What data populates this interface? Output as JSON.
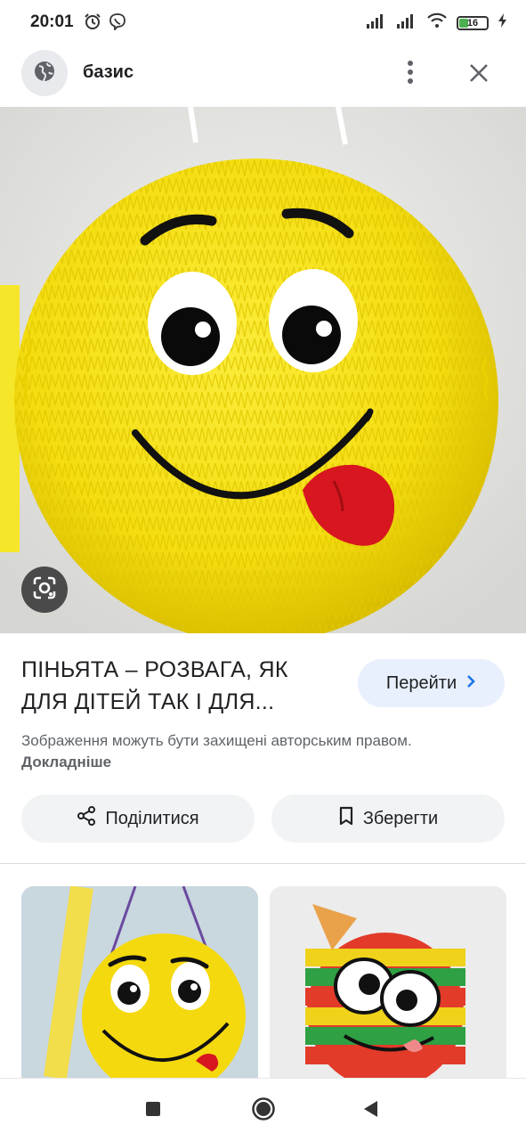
{
  "status_bar": {
    "time": "20:01",
    "battery": "16",
    "icons_left": [
      "alarm-icon",
      "viber-icon"
    ],
    "icons_right": [
      "signal-icon",
      "signal-icon",
      "wifi-icon",
      "battery-icon",
      "charging-icon"
    ]
  },
  "top_bar": {
    "site_name": "базис",
    "icons": [
      "globe-icon",
      "more-vert-icon",
      "close-icon"
    ]
  },
  "image_viewer": {
    "lens_icon": "google-lens-icon"
  },
  "result": {
    "title": "ПІНЬЯТА – РОЗВАГА, ЯК ДЛЯ ДІТЕЙ ТАК І ДЛЯ...",
    "visit_label": "Перейти",
    "copyright_text": "Зображення можуть бути захищені авторським правом.",
    "learn_more": "Докладніше",
    "share_label": "Поділитися",
    "save_label": "Зберегти"
  },
  "colors": {
    "accent": "#1a73e8",
    "visit_bg": "#e8f0fe",
    "button_bg": "#f1f3f4",
    "pinata_yellow": "#f7e219",
    "tongue_red": "#d7161f"
  },
  "nav": {
    "icons": [
      "recents-icon",
      "home-icon",
      "back-icon"
    ]
  }
}
